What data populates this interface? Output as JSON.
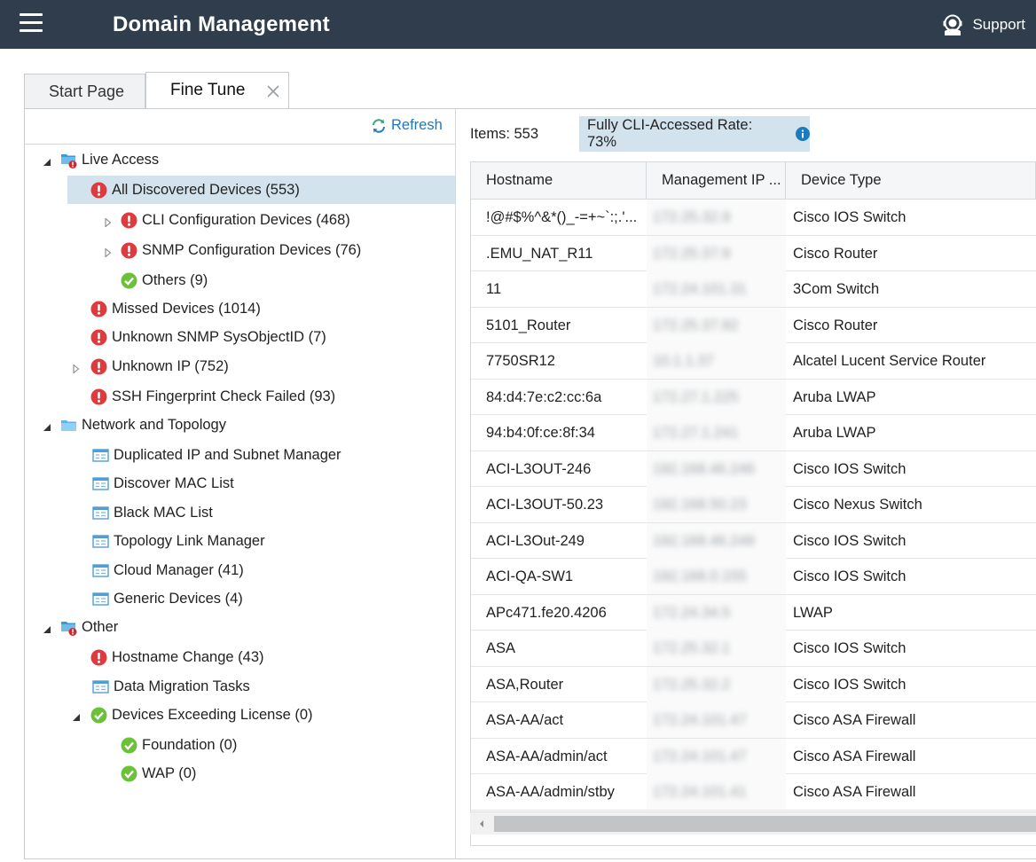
{
  "header": {
    "title": "Domain Management",
    "support_label": "Support"
  },
  "tabs": [
    {
      "label": "Start Page",
      "active": false
    },
    {
      "label": "Fine Tune",
      "active": true
    }
  ],
  "left": {
    "refresh_label": "Refresh"
  },
  "tree": [
    {
      "label": "Live Access",
      "icon": "folder-alert-icon",
      "expander": "expanded"
    },
    {
      "label": "All Discovered Devices (553)",
      "icon": "error-icon",
      "expander": "expanded",
      "selected": true
    },
    {
      "label": "CLI Configuration Devices (468)",
      "icon": "error-icon",
      "expander": "collapsed"
    },
    {
      "label": "SNMP Configuration Devices (76)",
      "icon": "error-icon",
      "expander": "collapsed"
    },
    {
      "label": "Others (9)",
      "icon": "ok-icon",
      "expander": "none"
    },
    {
      "label": "Missed Devices (1014)",
      "icon": "error-icon",
      "expander": "none"
    },
    {
      "label": "Unknown SNMP SysObjectID (7)",
      "icon": "error-icon",
      "expander": "none"
    },
    {
      "label": "Unknown IP (752)",
      "icon": "error-icon",
      "expander": "collapsed"
    },
    {
      "label": "SSH Fingerprint Check Failed (93)",
      "icon": "error-icon",
      "expander": "none"
    },
    {
      "label": "Network and Topology",
      "icon": "folder-icon",
      "expander": "expanded"
    },
    {
      "label": "Duplicated IP and Subnet Manager",
      "icon": "table-icon",
      "expander": "none"
    },
    {
      "label": "Discover MAC List",
      "icon": "table-icon",
      "expander": "none"
    },
    {
      "label": "Black MAC List",
      "icon": "table-icon",
      "expander": "none"
    },
    {
      "label": "Topology Link Manager",
      "icon": "table-icon",
      "expander": "none"
    },
    {
      "label": "Cloud Manager (41)",
      "icon": "table-icon",
      "expander": "none"
    },
    {
      "label": "Generic Devices (4)",
      "icon": "table-icon",
      "expander": "none"
    },
    {
      "label": "Other",
      "icon": "folder-alert-icon",
      "expander": "expanded"
    },
    {
      "label": "Hostname Change (43)",
      "icon": "error-icon",
      "expander": "none"
    },
    {
      "label": "Data Migration Tasks",
      "icon": "table-icon",
      "expander": "none"
    },
    {
      "label": "Devices Exceeding License (0)",
      "icon": "ok-icon",
      "expander": "expanded"
    },
    {
      "label": "Foundation (0)",
      "icon": "ok-icon",
      "expander": "none"
    },
    {
      "label": "WAP (0)",
      "icon": "ok-icon",
      "expander": "none"
    }
  ],
  "summary": {
    "items_label": "Items: 553",
    "rate_label": "Fully CLI-Accessed Rate: 73%"
  },
  "grid": {
    "columns": [
      "Hostname",
      "Management IP ...",
      "Device Type"
    ],
    "rows": [
      {
        "hostname": "!@#$%^&*()_-=+~`:;.'...",
        "ip": "172.25.32.9",
        "type": "Cisco IOS Switch"
      },
      {
        "hostname": ".EMU_NAT_R11",
        "ip": "172.25.37.9",
        "type": "Cisco Router"
      },
      {
        "hostname": "11",
        "ip": "172.24.101.31",
        "type": "3Com Switch"
      },
      {
        "hostname": "5101_Router",
        "ip": "172.25.37.82",
        "type": "Cisco Router"
      },
      {
        "hostname": "7750SR12",
        "ip": "10.1.1.37",
        "type": "Alcatel Lucent Service Router"
      },
      {
        "hostname": "84:d4:7e:c2:cc:6a",
        "ip": "172.27.1.225",
        "type": "Aruba LWAP"
      },
      {
        "hostname": "94:b4:0f:ce:8f:34",
        "ip": "172.27.1.241",
        "type": "Aruba LWAP"
      },
      {
        "hostname": "ACI-L3OUT-246",
        "ip": "192.168.46.246",
        "type": "Cisco IOS Switch"
      },
      {
        "hostname": "ACI-L3OUT-50.23",
        "ip": "192.168.50.23",
        "type": "Cisco Nexus Switch"
      },
      {
        "hostname": "ACI-L3Out-249",
        "ip": "192.168.46.249",
        "type": "Cisco IOS Switch"
      },
      {
        "hostname": "ACI-QA-SW1",
        "ip": "192.168.0.155",
        "type": "Cisco IOS Switch"
      },
      {
        "hostname": "APc471.fe20.4206",
        "ip": "172.24.34.5",
        "type": "LWAP"
      },
      {
        "hostname": "ASA",
        "ip": "172.25.32.1",
        "type": "Cisco IOS Switch"
      },
      {
        "hostname": "ASA,Router",
        "ip": "172.25.32.2",
        "type": "Cisco IOS Switch"
      },
      {
        "hostname": "ASA-AA/act",
        "ip": "172.24.101.47",
        "type": "Cisco ASA Firewall"
      },
      {
        "hostname": "ASA-AA/admin/act",
        "ip": "172.24.101.47",
        "type": "Cisco ASA Firewall"
      },
      {
        "hostname": "ASA-AA/admin/stby",
        "ip": "172.24.101.41",
        "type": "Cisco ASA Firewall"
      }
    ]
  },
  "colors": {
    "header_bg": "#2f3d4c",
    "selection": "#d3e3ee",
    "error": "#e0393e",
    "ok": "#6cc03a",
    "link": "#1a7bbf"
  }
}
